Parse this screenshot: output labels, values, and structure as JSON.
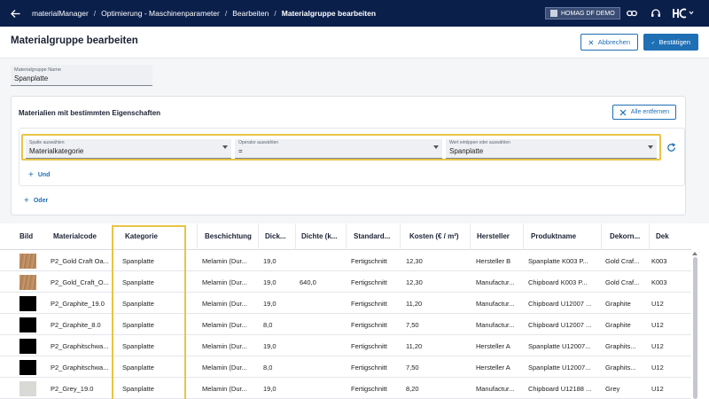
{
  "topbar": {
    "app_name": "materialManager",
    "breadcrumbs": [
      "Optimierung - Maschinenparameter",
      "Bearbeiten"
    ],
    "current": "Materialgruppe bearbeiten",
    "tenant": "HOMAG DF DEMO",
    "brand_icon": "homag-logo-icon"
  },
  "header": {
    "title": "Materialgruppe bearbeiten",
    "cancel_label": "Abbrechen",
    "confirm_label": "Bestätigen"
  },
  "name_field": {
    "label": "Materialgruppe Name",
    "value": "Spanplatte"
  },
  "properties": {
    "title": "Materialien mit bestimmten Eigenschaften",
    "clear_all_label": "Alle entfernen",
    "condition": {
      "column_label": "Spalte auswählen",
      "column_value": "Materialkategorie",
      "operator_label": "Operator auswählen",
      "operator_value": "=",
      "value_label": "Wert eintippen oder auswählen",
      "value_value": "Spanplatte"
    },
    "and_label": "Und",
    "or_label": "Oder"
  },
  "table": {
    "columns": [
      "Bild",
      "Materialcode",
      "Kategorie",
      "Beschichtung",
      "Dick...",
      "Dichte (k...",
      "Standard...",
      "Kosten (€ / m²)",
      "Hersteller",
      "Produktname",
      "Dekorn...",
      "Dek"
    ],
    "rows": [
      {
        "thumb": "wood",
        "code": "P2_Gold Craft Oa...",
        "kategorie": "Spanplatte",
        "beschichtung": "Melamin (Dur...",
        "dicke": "19,0",
        "dichte": "",
        "standard": "Fertigschnitt",
        "kosten": "12,30",
        "hersteller": "Hersteller B",
        "produkt": "Spanplatte K003 P...",
        "dekor": "Gold Craf...",
        "dek": "K003"
      },
      {
        "thumb": "wood",
        "code": "P2_Gold_Craft_O...",
        "kategorie": "Spanplatte",
        "beschichtung": "Melamin (Dur...",
        "dicke": "19,0",
        "dichte": "640,0",
        "standard": "Fertigschnitt",
        "kosten": "12,30",
        "hersteller": "Manufactur...",
        "produkt": "Chipboard K003 P...",
        "dekor": "Gold Craf...",
        "dek": "K003"
      },
      {
        "thumb": "black",
        "code": "P2_Graphite_19.0",
        "kategorie": "Spanplatte",
        "beschichtung": "Melamin (Dur...",
        "dicke": "19,0",
        "dichte": "",
        "standard": "Fertigschnitt",
        "kosten": "11,20",
        "hersteller": "Manufactur...",
        "produkt": "Chipboard U12007 ...",
        "dekor": "Graphite",
        "dek": "U12"
      },
      {
        "thumb": "black",
        "code": "P2_Graphite_8.0",
        "kategorie": "Spanplatte",
        "beschichtung": "Melamin (Dur...",
        "dicke": "8,0",
        "dichte": "",
        "standard": "Fertigschnitt",
        "kosten": "7,50",
        "hersteller": "Manufactur...",
        "produkt": "Chipboard U12007 ...",
        "dekor": "Graphite",
        "dek": "U12"
      },
      {
        "thumb": "black",
        "code": "P2_Graphitschwa...",
        "kategorie": "Spanplatte",
        "beschichtung": "Melamin (Dur...",
        "dicke": "19,0",
        "dichte": "",
        "standard": "Fertigschnitt",
        "kosten": "11,20",
        "hersteller": "Hersteller A",
        "produkt": "Spanplatte U12007...",
        "dekor": "Graphits...",
        "dek": "U12"
      },
      {
        "thumb": "black",
        "code": "P2_Graphitschwa...",
        "kategorie": "Spanplatte",
        "beschichtung": "Melamin (Dur...",
        "dicke": "8,0",
        "dichte": "",
        "standard": "Fertigschnitt",
        "kosten": "7,50",
        "hersteller": "Hersteller A",
        "produkt": "Spanplatte U12007...",
        "dekor": "Graphits...",
        "dek": "U12"
      },
      {
        "thumb": "grey",
        "code": "P2_Grey_19.0",
        "kategorie": "Spanplatte",
        "beschichtung": "Melamin (Dur...",
        "dicke": "19,0",
        "dichte": "",
        "standard": "Fertigschnitt",
        "kosten": "8,20",
        "hersteller": "Manufactur...",
        "produkt": "Chipboard U12188 ...",
        "dekor": "Grey",
        "dek": "U12"
      }
    ]
  },
  "colors": {
    "topbar": "#0b1f4b",
    "accent": "#1f6fb5",
    "highlight": "#e8c445"
  }
}
